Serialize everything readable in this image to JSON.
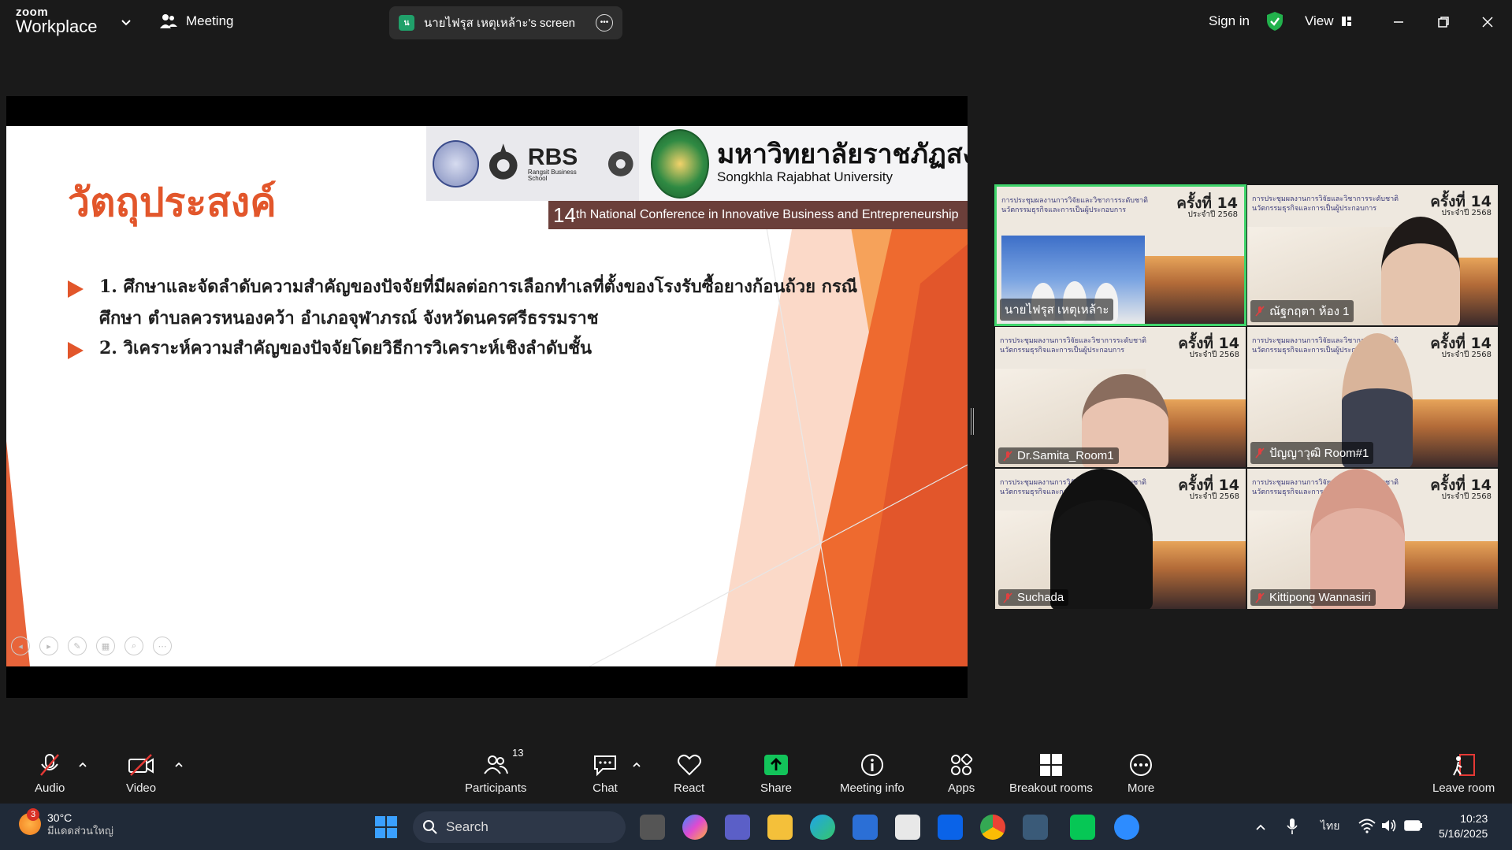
{
  "app": {
    "brand_small": "zoom",
    "brand_big": "Workplace"
  },
  "topbar": {
    "meeting_label": "Meeting",
    "share_avatar": "น",
    "share_title": "นายไฟรุส เหตุเหล้าะ's screen",
    "sign_in": "Sign in",
    "view": "View"
  },
  "slide": {
    "title": "วัตถุประสงค์",
    "rbs_name": "RBS",
    "rbs_sub": "Rangsit Business School",
    "university_thai": "มหาวิทยาลัยราชภัฏสงขลา",
    "university_en": "Songkhla Rajabhat University",
    "conference_num": "14",
    "conference_text": "th National Conference in Innovative Business and Entrepreneurship",
    "bullets": [
      "1. ศึกษาและจัดลำดับความสำคัญของปัจจัยที่มีผลต่อการเลือกทำเลที่ตั้งของโรงรับซื้อยางก้อนถ้วย กรณีศึกษา ตำบลควรหนองคว้า อำเภอจุฬาภรณ์ จังหวัดนครศรีธรรมราช",
      "2. วิเคราะห์ความสำคัญของปัจจัยโดยวิธีการวิเคราะห์เชิงลำดับชั้น"
    ]
  },
  "gallery": {
    "banner_line1": "การประชุมผลงานการวิจัยและวิชาการระดับชาติ",
    "banner_line2": "นวัตกรรมธุรกิจและการเป็นผู้ประกอบการ",
    "round": "ครั้งที่ 14",
    "year": "ประจำปี 2568",
    "tiles": [
      {
        "name": "นายไฟรุส เหตุเหล้าะ",
        "muted": false,
        "active": true
      },
      {
        "name": "ณัฐกฤตา ห้อง 1",
        "muted": true,
        "active": false
      },
      {
        "name": "Dr.Samita_Room1",
        "muted": true,
        "active": false
      },
      {
        "name": "ปัญญาวุฒิ Room#1",
        "muted": true,
        "active": false
      },
      {
        "name": "Suchada",
        "muted": true,
        "active": false
      },
      {
        "name": "Kittipong Wannasiri",
        "muted": true,
        "active": false
      }
    ]
  },
  "toolbar": {
    "audio": "Audio",
    "video": "Video",
    "participants": "Participants",
    "participants_count": "13",
    "chat": "Chat",
    "react": "React",
    "share": "Share",
    "meeting_info": "Meeting info",
    "apps": "Apps",
    "breakout": "Breakout rooms",
    "more": "More",
    "leave": "Leave room"
  },
  "taskbar": {
    "weather_badge": "3",
    "temperature": "30°C",
    "condition": "มีแดดส่วนใหญ่",
    "search": "Search",
    "lang": "ไทย",
    "time": "10:23",
    "date": "5/16/2025"
  },
  "colors": {
    "accent_green": "#3fd46b",
    "slide_orange": "#e2562b",
    "share_green": "#12c45a"
  }
}
